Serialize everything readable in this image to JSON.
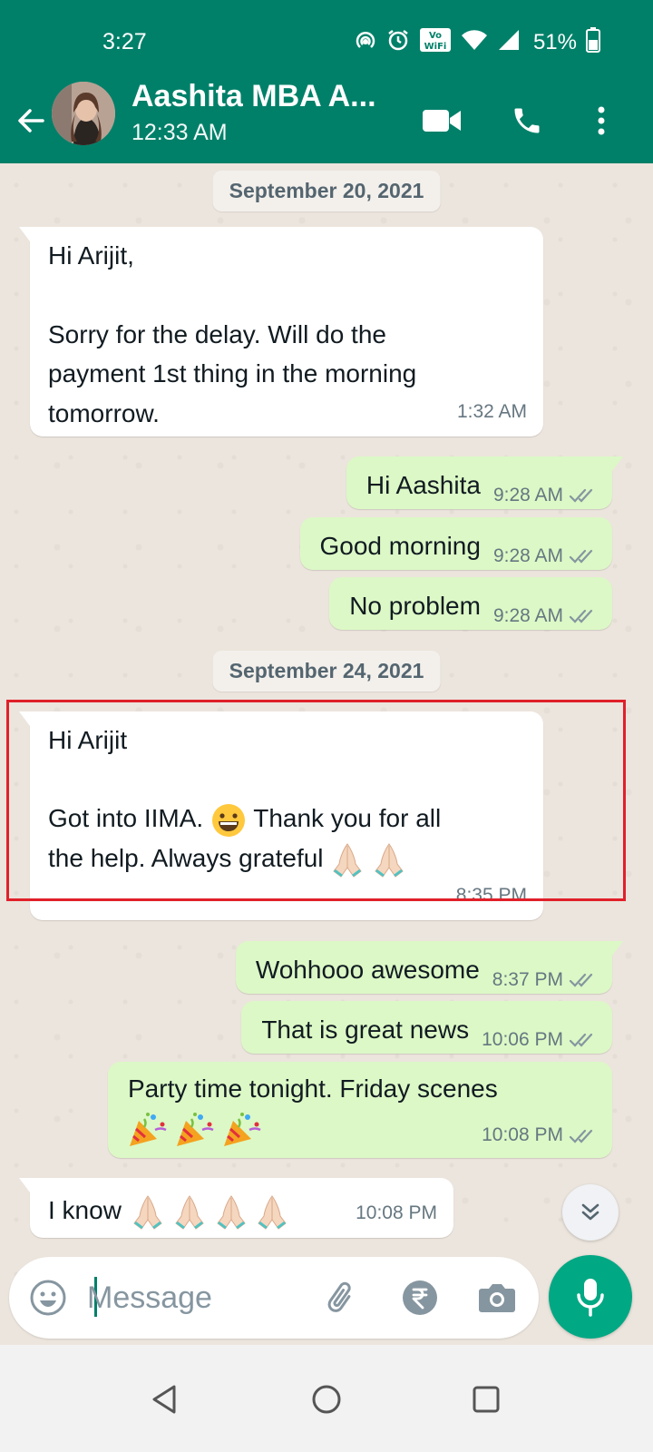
{
  "status_bar": {
    "time": "3:27",
    "volte_label": "VoWiFi",
    "battery_percent": "51%",
    "icons": [
      "hotspot-icon",
      "alarm-icon",
      "vowifi-icon",
      "wifi-icon",
      "cell-signal-icon",
      "battery-icon"
    ]
  },
  "header": {
    "contact_name": "Aashita MBA A...",
    "last_seen": "12:33 AM",
    "icons": [
      "back-arrow-icon",
      "video-call-icon",
      "voice-call-icon",
      "more-options-icon"
    ]
  },
  "chat": {
    "date_1": "September 20, 2021",
    "date_2": "September 24, 2021",
    "messages": [
      {
        "dir": "in",
        "text": "Hi Arijit,\n\nSorry for the delay. Will do the\npayment 1st thing in the morning\ntomorrow.",
        "time": "1:32 AM"
      },
      {
        "dir": "out",
        "text": "Hi Aashita",
        "time": "9:28 AM",
        "status": "read"
      },
      {
        "dir": "out",
        "text": "Good morning",
        "time": "9:28 AM",
        "status": "read"
      },
      {
        "dir": "out",
        "text": "No problem",
        "time": "9:28 AM",
        "status": "read"
      },
      {
        "dir": "in",
        "line1": "Hi Arijit",
        "line2a": "Got into IIMA.",
        "line2b": "Thank you for all",
        "line3": "the help. Always grateful",
        "time": "8:35 PM",
        "emojis": [
          "grinning-face",
          "folded-hands",
          "folded-hands"
        ]
      },
      {
        "dir": "out",
        "text": "Wohhooo awesome",
        "time": "8:37 PM",
        "status": "read"
      },
      {
        "dir": "out",
        "text": "That is great news",
        "time": "10:06 PM",
        "status": "read"
      },
      {
        "dir": "out",
        "text": "Party time tonight. Friday scenes",
        "time": "10:08 PM",
        "status": "read",
        "emojis": [
          "party-popper",
          "party-popper",
          "party-popper"
        ]
      },
      {
        "dir": "in",
        "text": "I know",
        "time": "10:08 PM",
        "emojis": [
          "folded-hands",
          "folded-hands",
          "folded-hands",
          "folded-hands"
        ]
      }
    ]
  },
  "composer": {
    "placeholder": "Message",
    "icons": [
      "emoji-icon",
      "attach-icon",
      "rupee-payment-icon",
      "camera-icon",
      "mic-icon"
    ]
  },
  "colors": {
    "header": "#008069",
    "outgoing_bubble": "#dcf8c6",
    "incoming_bubble": "#ffffff",
    "chat_bg": "#ece5dd",
    "read_ticks": "#8696a0",
    "mic_button": "#00a884",
    "highlight_box": "#e0202a"
  }
}
